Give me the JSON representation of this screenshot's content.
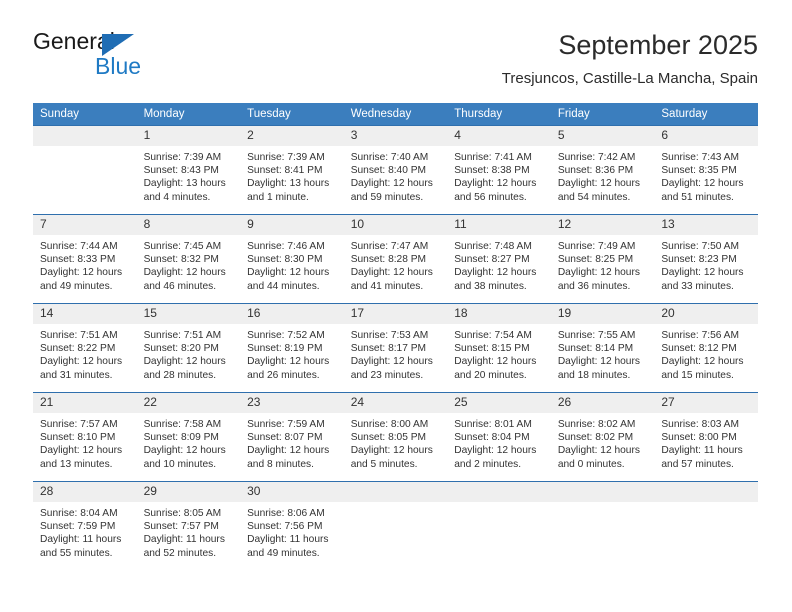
{
  "logo": {
    "word1": "General",
    "word2": "Blue",
    "triangle_color": "#1f6db4",
    "blue_text_color": "#1f7ac4"
  },
  "header": {
    "title": "September 2025",
    "subtitle": "Tresjuncos, Castille-La Mancha, Spain"
  },
  "theme": {
    "header_blue": "#3b7ebe",
    "row_divider": "#2f6fad",
    "daynum_background": "#efefef"
  },
  "weekday_headers": [
    "Sunday",
    "Monday",
    "Tuesday",
    "Wednesday",
    "Thursday",
    "Friday",
    "Saturday"
  ],
  "weeks": [
    [
      {
        "day": "",
        "sunrise": "",
        "sunset": "",
        "daylight": ""
      },
      {
        "day": "1",
        "sunrise": "Sunrise: 7:39 AM",
        "sunset": "Sunset: 8:43 PM",
        "daylight": "Daylight: 13 hours and 4 minutes."
      },
      {
        "day": "2",
        "sunrise": "Sunrise: 7:39 AM",
        "sunset": "Sunset: 8:41 PM",
        "daylight": "Daylight: 13 hours and 1 minute."
      },
      {
        "day": "3",
        "sunrise": "Sunrise: 7:40 AM",
        "sunset": "Sunset: 8:40 PM",
        "daylight": "Daylight: 12 hours and 59 minutes."
      },
      {
        "day": "4",
        "sunrise": "Sunrise: 7:41 AM",
        "sunset": "Sunset: 8:38 PM",
        "daylight": "Daylight: 12 hours and 56 minutes."
      },
      {
        "day": "5",
        "sunrise": "Sunrise: 7:42 AM",
        "sunset": "Sunset: 8:36 PM",
        "daylight": "Daylight: 12 hours and 54 minutes."
      },
      {
        "day": "6",
        "sunrise": "Sunrise: 7:43 AM",
        "sunset": "Sunset: 8:35 PM",
        "daylight": "Daylight: 12 hours and 51 minutes."
      }
    ],
    [
      {
        "day": "7",
        "sunrise": "Sunrise: 7:44 AM",
        "sunset": "Sunset: 8:33 PM",
        "daylight": "Daylight: 12 hours and 49 minutes."
      },
      {
        "day": "8",
        "sunrise": "Sunrise: 7:45 AM",
        "sunset": "Sunset: 8:32 PM",
        "daylight": "Daylight: 12 hours and 46 minutes."
      },
      {
        "day": "9",
        "sunrise": "Sunrise: 7:46 AM",
        "sunset": "Sunset: 8:30 PM",
        "daylight": "Daylight: 12 hours and 44 minutes."
      },
      {
        "day": "10",
        "sunrise": "Sunrise: 7:47 AM",
        "sunset": "Sunset: 8:28 PM",
        "daylight": "Daylight: 12 hours and 41 minutes."
      },
      {
        "day": "11",
        "sunrise": "Sunrise: 7:48 AM",
        "sunset": "Sunset: 8:27 PM",
        "daylight": "Daylight: 12 hours and 38 minutes."
      },
      {
        "day": "12",
        "sunrise": "Sunrise: 7:49 AM",
        "sunset": "Sunset: 8:25 PM",
        "daylight": "Daylight: 12 hours and 36 minutes."
      },
      {
        "day": "13",
        "sunrise": "Sunrise: 7:50 AM",
        "sunset": "Sunset: 8:23 PM",
        "daylight": "Daylight: 12 hours and 33 minutes."
      }
    ],
    [
      {
        "day": "14",
        "sunrise": "Sunrise: 7:51 AM",
        "sunset": "Sunset: 8:22 PM",
        "daylight": "Daylight: 12 hours and 31 minutes."
      },
      {
        "day": "15",
        "sunrise": "Sunrise: 7:51 AM",
        "sunset": "Sunset: 8:20 PM",
        "daylight": "Daylight: 12 hours and 28 minutes."
      },
      {
        "day": "16",
        "sunrise": "Sunrise: 7:52 AM",
        "sunset": "Sunset: 8:19 PM",
        "daylight": "Daylight: 12 hours and 26 minutes."
      },
      {
        "day": "17",
        "sunrise": "Sunrise: 7:53 AM",
        "sunset": "Sunset: 8:17 PM",
        "daylight": "Daylight: 12 hours and 23 minutes."
      },
      {
        "day": "18",
        "sunrise": "Sunrise: 7:54 AM",
        "sunset": "Sunset: 8:15 PM",
        "daylight": "Daylight: 12 hours and 20 minutes."
      },
      {
        "day": "19",
        "sunrise": "Sunrise: 7:55 AM",
        "sunset": "Sunset: 8:14 PM",
        "daylight": "Daylight: 12 hours and 18 minutes."
      },
      {
        "day": "20",
        "sunrise": "Sunrise: 7:56 AM",
        "sunset": "Sunset: 8:12 PM",
        "daylight": "Daylight: 12 hours and 15 minutes."
      }
    ],
    [
      {
        "day": "21",
        "sunrise": "Sunrise: 7:57 AM",
        "sunset": "Sunset: 8:10 PM",
        "daylight": "Daylight: 12 hours and 13 minutes."
      },
      {
        "day": "22",
        "sunrise": "Sunrise: 7:58 AM",
        "sunset": "Sunset: 8:09 PM",
        "daylight": "Daylight: 12 hours and 10 minutes."
      },
      {
        "day": "23",
        "sunrise": "Sunrise: 7:59 AM",
        "sunset": "Sunset: 8:07 PM",
        "daylight": "Daylight: 12 hours and 8 minutes."
      },
      {
        "day": "24",
        "sunrise": "Sunrise: 8:00 AM",
        "sunset": "Sunset: 8:05 PM",
        "daylight": "Daylight: 12 hours and 5 minutes."
      },
      {
        "day": "25",
        "sunrise": "Sunrise: 8:01 AM",
        "sunset": "Sunset: 8:04 PM",
        "daylight": "Daylight: 12 hours and 2 minutes."
      },
      {
        "day": "26",
        "sunrise": "Sunrise: 8:02 AM",
        "sunset": "Sunset: 8:02 PM",
        "daylight": "Daylight: 12 hours and 0 minutes."
      },
      {
        "day": "27",
        "sunrise": "Sunrise: 8:03 AM",
        "sunset": "Sunset: 8:00 PM",
        "daylight": "Daylight: 11 hours and 57 minutes."
      }
    ],
    [
      {
        "day": "28",
        "sunrise": "Sunrise: 8:04 AM",
        "sunset": "Sunset: 7:59 PM",
        "daylight": "Daylight: 11 hours and 55 minutes."
      },
      {
        "day": "29",
        "sunrise": "Sunrise: 8:05 AM",
        "sunset": "Sunset: 7:57 PM",
        "daylight": "Daylight: 11 hours and 52 minutes."
      },
      {
        "day": "30",
        "sunrise": "Sunrise: 8:06 AM",
        "sunset": "Sunset: 7:56 PM",
        "daylight": "Daylight: 11 hours and 49 minutes."
      },
      {
        "day": "",
        "sunrise": "",
        "sunset": "",
        "daylight": ""
      },
      {
        "day": "",
        "sunrise": "",
        "sunset": "",
        "daylight": ""
      },
      {
        "day": "",
        "sunrise": "",
        "sunset": "",
        "daylight": ""
      },
      {
        "day": "",
        "sunrise": "",
        "sunset": "",
        "daylight": ""
      }
    ]
  ]
}
